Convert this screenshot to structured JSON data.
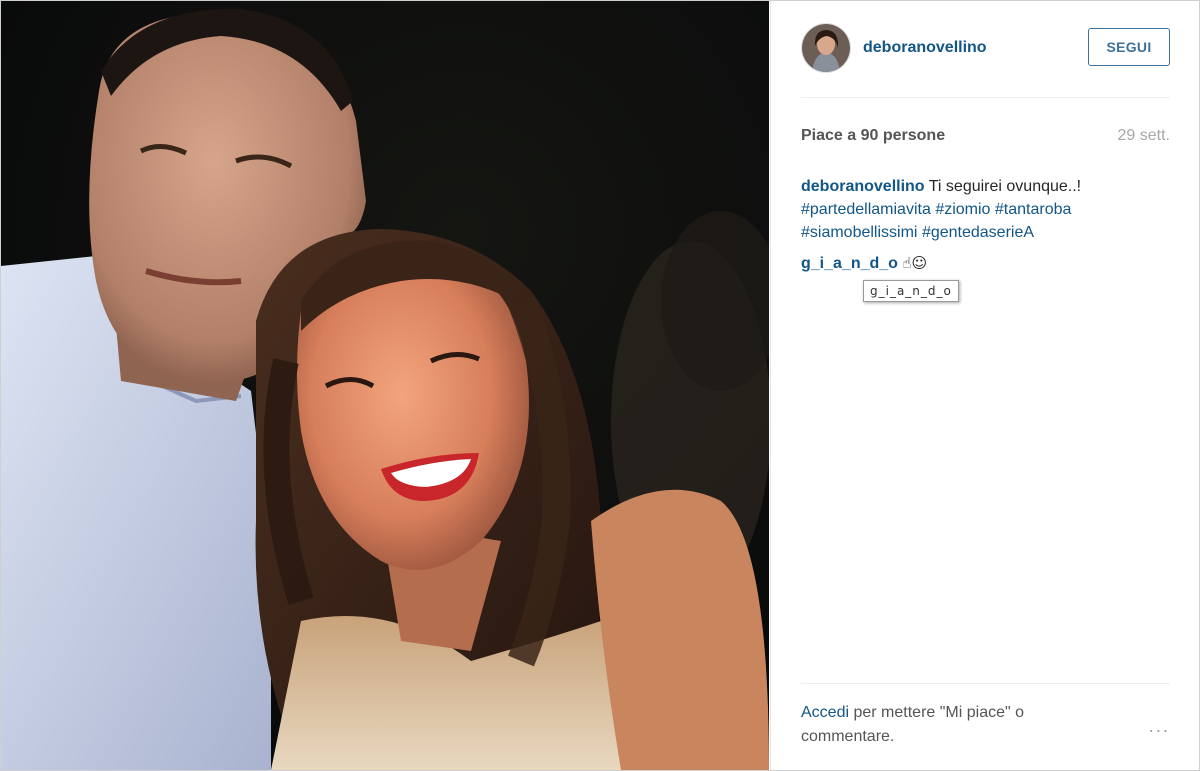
{
  "post": {
    "username": "deboranovellino",
    "follow_label": "SEGUI",
    "likes_text": "Piace a 90 persone",
    "date": "29 sett.",
    "caption_text": "Ti seguirei ovunque..!",
    "hashtags": [
      "#partedellamiavita",
      "#ziomio",
      "#tantaroba",
      "#siamobellissimi",
      "#gentedaserieA"
    ],
    "comment": {
      "author": "g_i_a_n_d_o",
      "emoji_text": "☝☺",
      "tooltip": "g_i_a_n_d_o"
    }
  },
  "footer": {
    "login_link": "Accedi",
    "login_text_line1": " per mettere \"Mi piace\" o",
    "login_text_line2": "commentare.",
    "more_icon": "..."
  },
  "colors": {
    "link": "#125688",
    "follow_border": "#3f729b",
    "muted": "#a5a7aa"
  },
  "icons": {
    "more": "more-dots-icon"
  }
}
